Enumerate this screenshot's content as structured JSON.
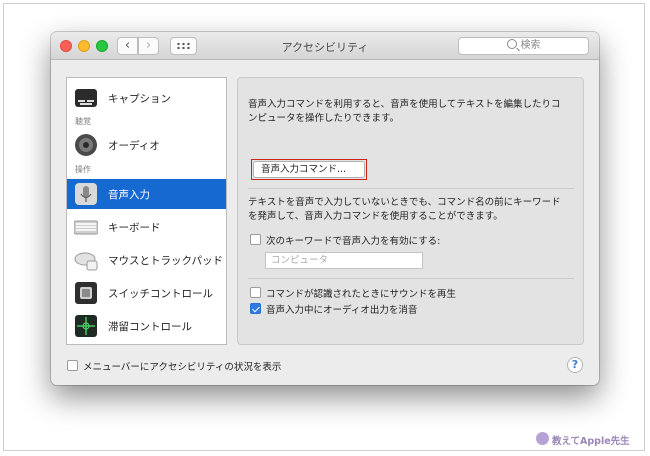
{
  "window": {
    "title": "アクセシビリティ"
  },
  "toolbar": {
    "search_placeholder": "検索",
    "back": "‹",
    "forward": "›"
  },
  "sidebar": {
    "groups": [
      {
        "label": "聴覚"
      },
      {
        "label": "操作"
      }
    ],
    "items": [
      {
        "label": "キャプション",
        "icon": "caption-icon",
        "selected": false
      },
      {
        "label": "オーディオ",
        "icon": "speaker-icon",
        "selected": false
      },
      {
        "label": "音声入力",
        "icon": "microphone-icon",
        "selected": true
      },
      {
        "label": "キーボード",
        "icon": "keyboard-icon",
        "selected": false
      },
      {
        "label": "マウスとトラックパッド",
        "icon": "mouse-icon",
        "selected": false
      },
      {
        "label": "スイッチコントロール",
        "icon": "switch-control-icon",
        "selected": false
      },
      {
        "label": "滞留コントロール",
        "icon": "dwell-control-icon",
        "selected": false
      }
    ]
  },
  "panel": {
    "intro": "音声入力コマンドを利用すると、音声を使用してテキストを編集したりコンピュータを操作したりできます。",
    "commands_button": "音声入力コマンド...",
    "keyword_desc": "テキストを音声で入力していないときでも、コマンド名の前にキーワードを発声して、音声入力コマンドを使用することができます。",
    "keyword_checkbox": {
      "label": "次のキーワードで音声入力を有効にする:",
      "checked": false
    },
    "keyword_field_placeholder": "コンピュータ",
    "sound_checkbox": {
      "label": "コマンドが認識されたときにサウンドを再生",
      "checked": false
    },
    "mute_checkbox": {
      "label": "音声入力中にオーディオ出力を消音",
      "checked": true
    }
  },
  "footer": {
    "menubar_checkbox": {
      "label": "メニューバーにアクセシビリティの状況を表示",
      "checked": false
    },
    "help": "?"
  },
  "watermark": "教えてApple先生",
  "colors": {
    "accent": "#1769d2",
    "highlight_box": "#d0231a"
  }
}
